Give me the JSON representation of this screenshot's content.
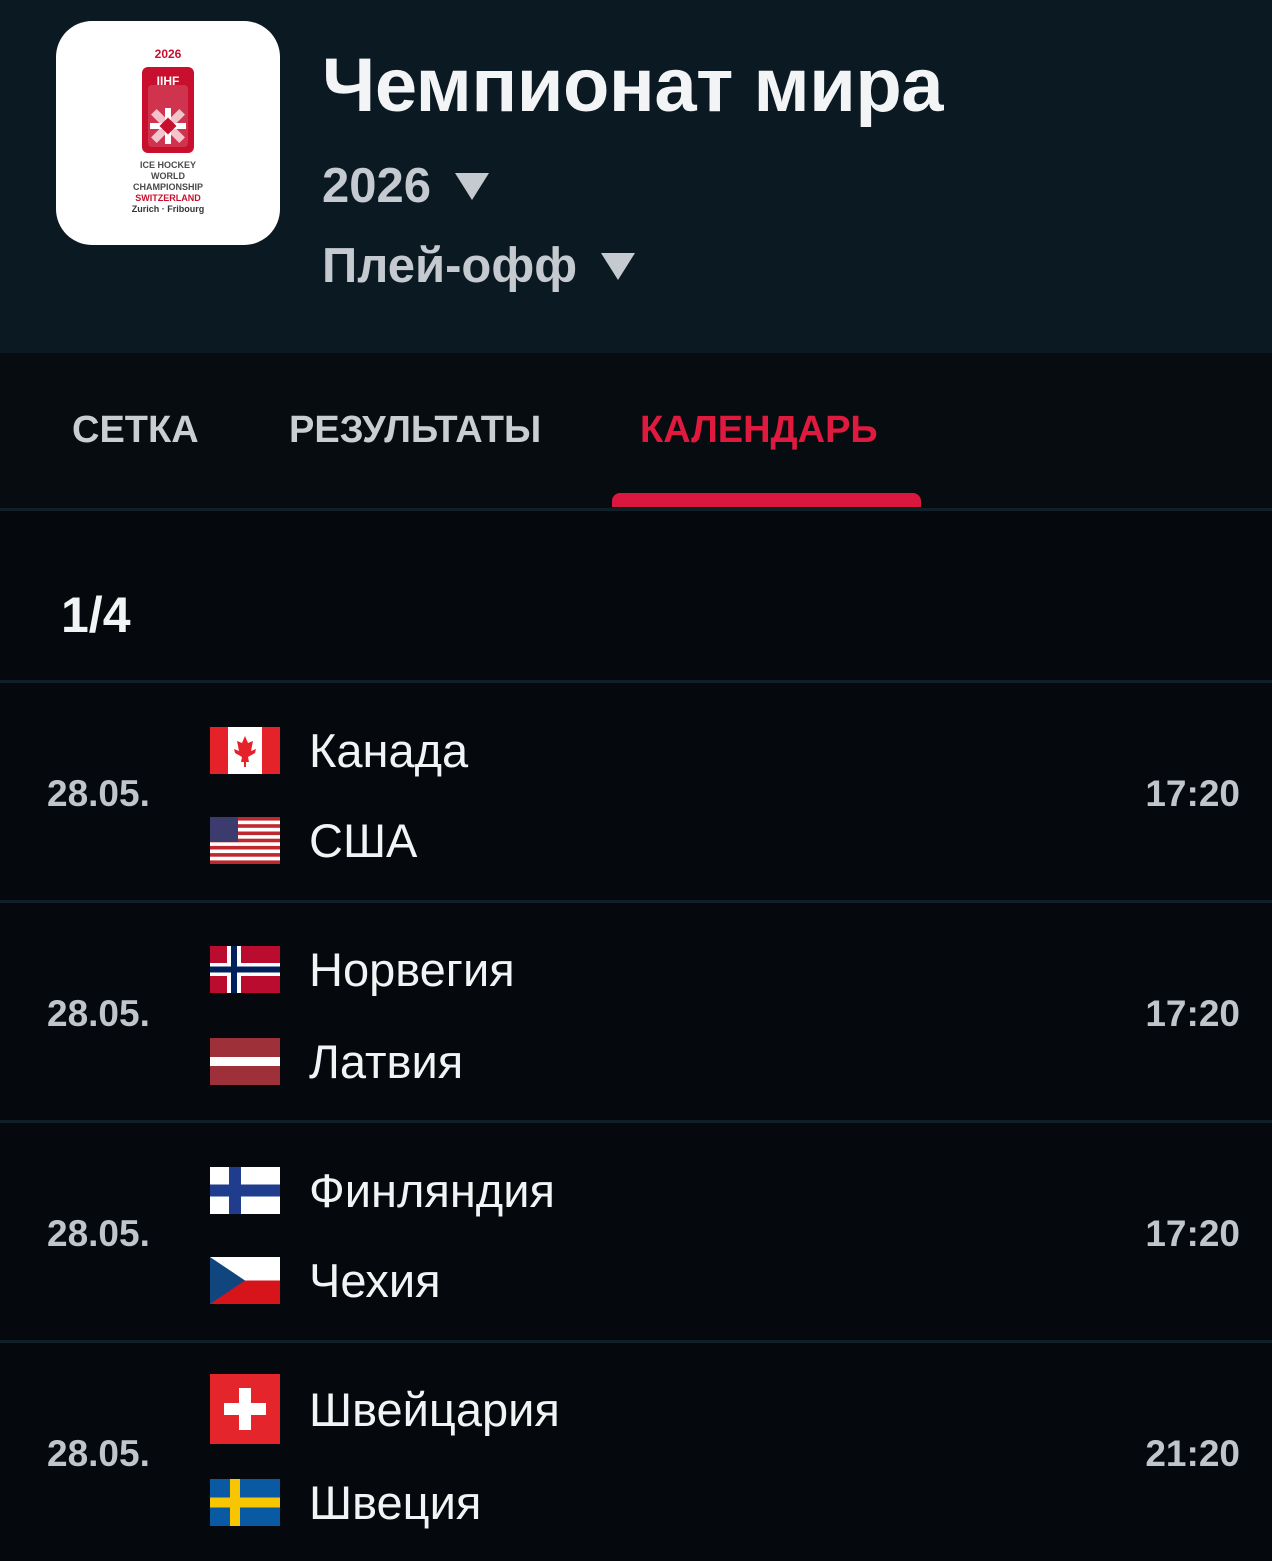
{
  "logo": {
    "year": "2026",
    "org": "IIHF",
    "lines": [
      "ICE HOCKEY",
      "WORLD",
      "CHAMPIONSHIP",
      "SWITZERLAND",
      "Zurich · Fribourg"
    ]
  },
  "header": {
    "title": "Чемпионат мира",
    "season": "2026",
    "stage": "Плей-офф"
  },
  "tabs": [
    {
      "label": "СЕТКА",
      "active": false
    },
    {
      "label": "РЕЗУЛЬТАТЫ",
      "active": false
    },
    {
      "label": "КАЛЕНДАРЬ",
      "active": true
    }
  ],
  "round": "1/4",
  "matches": [
    {
      "date": "28.05.",
      "time": "17:20",
      "home": {
        "name": "Канада",
        "flag": "canada-flag"
      },
      "away": {
        "name": "США",
        "flag": "usa-flag"
      }
    },
    {
      "date": "28.05.",
      "time": "17:20",
      "home": {
        "name": "Норвегия",
        "flag": "norway-flag"
      },
      "away": {
        "name": "Латвия",
        "flag": "latvia-flag"
      }
    },
    {
      "date": "28.05.",
      "time": "17:20",
      "home": {
        "name": "Финляндия",
        "flag": "finland-flag"
      },
      "away": {
        "name": "Чехия",
        "flag": "czechia-flag"
      }
    },
    {
      "date": "28.05.",
      "time": "21:20",
      "home": {
        "name": "Швейцария",
        "flag": "switzerland-flag"
      },
      "away": {
        "name": "Швеция",
        "flag": "sweden-flag"
      }
    }
  ],
  "colors": {
    "accent": "#d9173f",
    "header_bg": "#0b1a22",
    "page_bg": "#05090d"
  }
}
